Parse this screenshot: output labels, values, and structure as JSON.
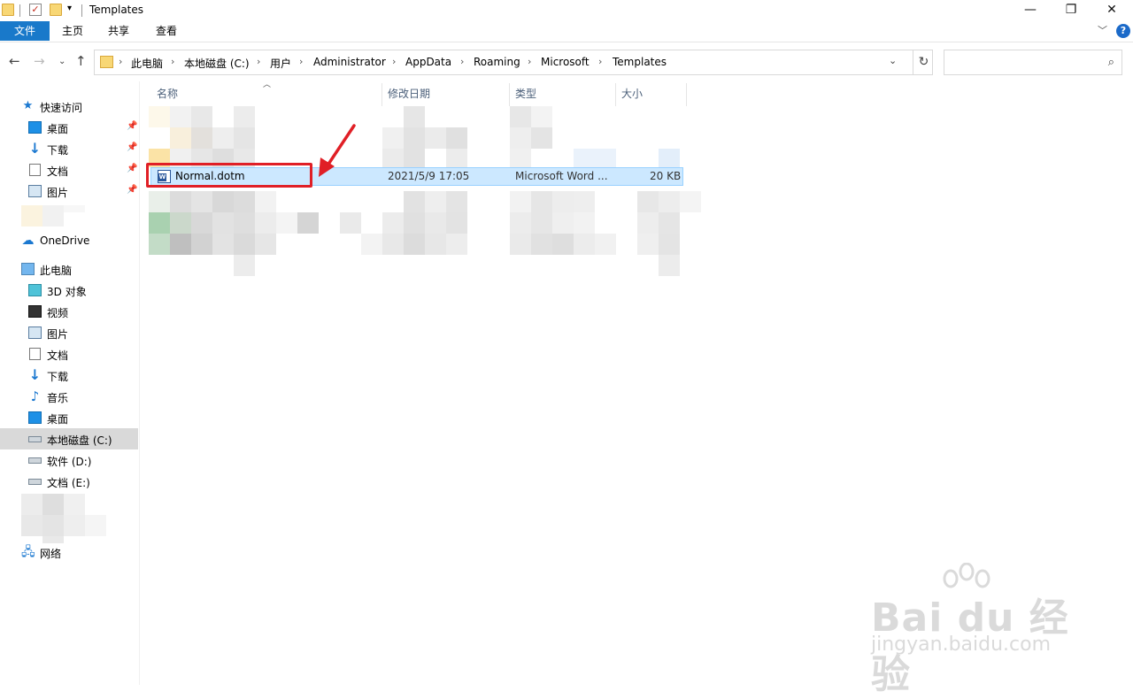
{
  "window": {
    "title": "Templates",
    "minimize": "—",
    "restore": "❐",
    "close": "✕"
  },
  "ribbon": {
    "tabs": [
      "文件",
      "主页",
      "共享",
      "查看"
    ],
    "help": "?"
  },
  "address": {
    "crumbs": [
      "此电脑",
      "本地磁盘 (C:)",
      "用户",
      "Administrator",
      "AppData",
      "Roaming",
      "Microsoft",
      "Templates"
    ],
    "search_placeholder": ""
  },
  "sidebar": {
    "quick_access": "快速访问",
    "quick_items": [
      "桌面",
      "下载",
      "文档",
      "图片"
    ],
    "onedrive": "OneDrive",
    "this_pc": "此电脑",
    "pc_items": [
      "3D 对象",
      "视频",
      "图片",
      "文档",
      "下载",
      "音乐",
      "桌面",
      "本地磁盘 (C:)",
      "软件 (D:)",
      "文档 (E:)"
    ],
    "network": "网络"
  },
  "columns": {
    "name": "名称",
    "date": "修改日期",
    "type": "类型",
    "size": "大小"
  },
  "file": {
    "name": "Normal.dotm",
    "date": "2021/5/9 17:05",
    "type": "Microsoft Word ...",
    "size": "20 KB"
  },
  "watermark": {
    "brand": "Bai du 经验",
    "url": "jingyan.baidu.com"
  },
  "colors": {
    "accent": "#1979ca",
    "selection": "#cce8ff",
    "highlight": "#e01f26"
  }
}
